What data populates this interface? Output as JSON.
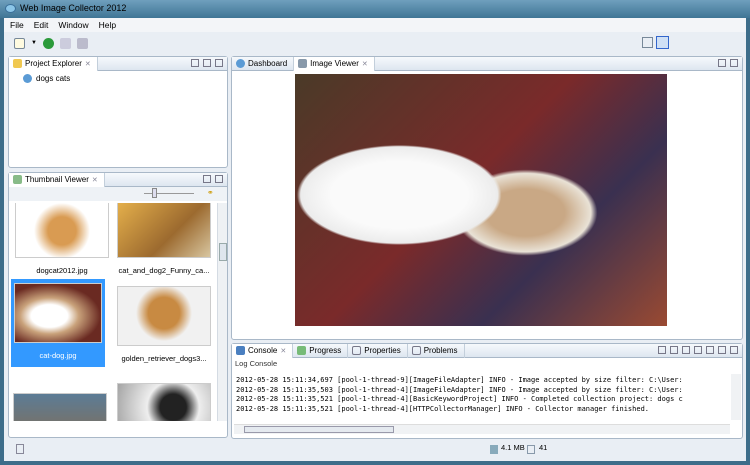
{
  "window": {
    "title": "Web Image Collector 2012"
  },
  "menu": [
    "File",
    "Edit",
    "Window",
    "Help"
  ],
  "project_explorer": {
    "tab": "Project Explorer",
    "items": [
      "dogs cats"
    ]
  },
  "thumbnail_viewer": {
    "tab": "Thumbnail Viewer",
    "items": [
      {
        "name": "dogcat2012.jpg",
        "selected": false
      },
      {
        "name": "cat_and_dog2_Funny_ca...",
        "selected": false
      },
      {
        "name": "cat-dog.jpg",
        "selected": true
      },
      {
        "name": "golden_retriever_dogs3...",
        "selected": false
      },
      {
        "name": "",
        "selected": false
      },
      {
        "name": "",
        "selected": false
      }
    ]
  },
  "editor": {
    "tabs": [
      "Dashboard",
      "Image Viewer"
    ],
    "active": "Image Viewer"
  },
  "console": {
    "tabs": [
      "Console",
      "Progress",
      "Properties",
      "Problems"
    ],
    "title": "Log Console",
    "lines": [
      "2012-05-28 15:11:34,697 [pool-1-thread-9][ImageFileAdapter] INFO  - Image accepted by size filter: C:\\User:",
      "2012-05-28 15:11:35,503 [pool-1-thread-4][ImageFileAdapter] INFO  - Image accepted by size filter: C:\\User:",
      "2012-05-28 15:11:35,521 [pool-1-thread-4][BasicKeywordProject] INFO  - Completed collection project: dogs c",
      "2012-05-28 15:11:35,521 [pool-1-thread-4][HTTPCollectorManager] INFO  - Collector manager finished."
    ]
  },
  "status": {
    "memory": "4.1 MB",
    "count": "41"
  }
}
